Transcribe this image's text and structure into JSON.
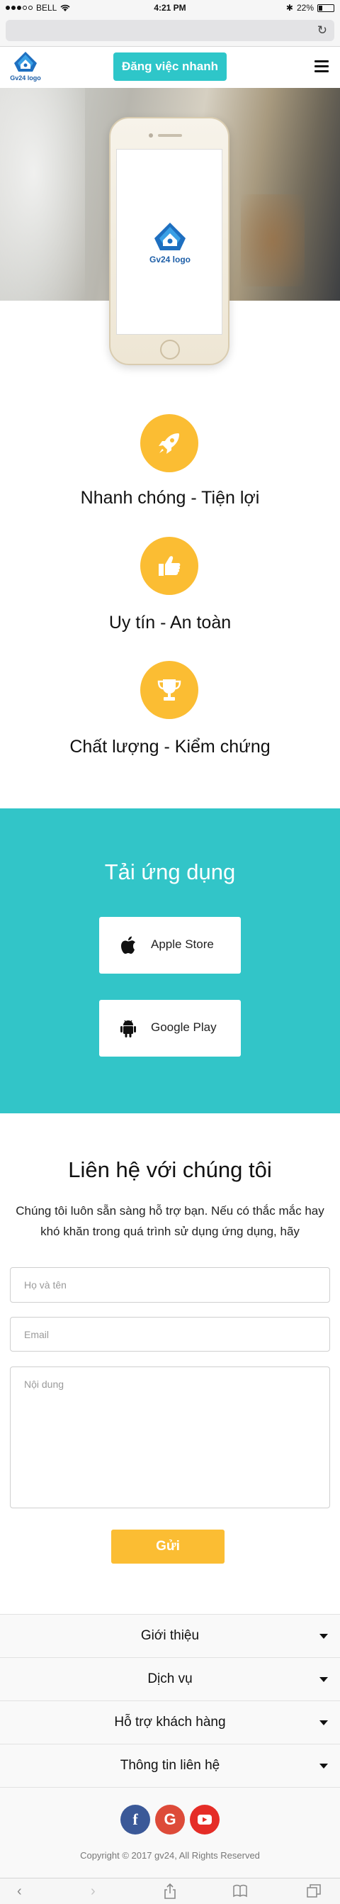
{
  "status_bar": {
    "carrier": "BELL",
    "time": "4:21 PM",
    "battery": "22%"
  },
  "header": {
    "logo_text": "Gv24 logo",
    "cta_label": "Đăng việc nhanh"
  },
  "hero": {
    "phone_logo_text": "Gv24 logo"
  },
  "features": [
    {
      "icon": "rocket-icon",
      "title": "Nhanh chóng - Tiện lợi"
    },
    {
      "icon": "thumbs-up-icon",
      "title": "Uy tín - An toàn"
    },
    {
      "icon": "trophy-icon",
      "title": "Chất lượng - Kiểm chứng"
    }
  ],
  "download": {
    "title": "Tải ứng dụng",
    "apple_label": "Apple Store",
    "google_label": "Google Play"
  },
  "contact": {
    "title": "Liên hệ với chúng tôi",
    "description": "Chúng tôi luôn sẵn sàng hỗ trợ bạn. Nếu có thắc mắc hay khó khăn trong quá trình sử dụng ứng dụng, hãy",
    "name_placeholder": "Họ và tên",
    "email_placeholder": "Email",
    "message_placeholder": "Nội dung",
    "send_label": "Gửi"
  },
  "footer": {
    "sections": [
      "Giới thiệu",
      "Dịch vụ",
      "Hỗ trợ khách hàng",
      "Thông tin liên hệ"
    ],
    "social": [
      "facebook-icon",
      "google-icon",
      "youtube-icon"
    ],
    "copyright": "Copyright © 2017 gv24, All Rights Reserved"
  },
  "colors": {
    "brand_teal": "#2ec6c9",
    "accent_yellow": "#fbbd33",
    "logo_blue": "#1e5fa8",
    "facebook": "#3b5998",
    "google": "#dd4b39",
    "youtube": "#e52d27"
  }
}
